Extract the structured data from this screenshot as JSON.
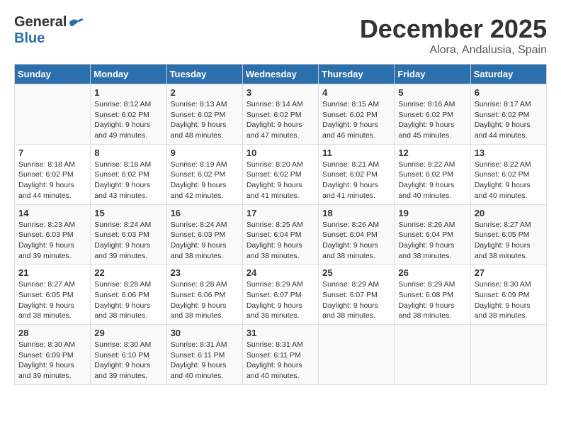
{
  "header": {
    "logo_general": "General",
    "logo_blue": "Blue",
    "month": "December 2025",
    "location": "Alora, Andalusia, Spain"
  },
  "days_of_week": [
    "Sunday",
    "Monday",
    "Tuesday",
    "Wednesday",
    "Thursday",
    "Friday",
    "Saturday"
  ],
  "weeks": [
    [
      {
        "day": "",
        "info": ""
      },
      {
        "day": "1",
        "info": "Sunrise: 8:12 AM\nSunset: 6:02 PM\nDaylight: 9 hours\nand 49 minutes."
      },
      {
        "day": "2",
        "info": "Sunrise: 8:13 AM\nSunset: 6:02 PM\nDaylight: 9 hours\nand 48 minutes."
      },
      {
        "day": "3",
        "info": "Sunrise: 8:14 AM\nSunset: 6:02 PM\nDaylight: 9 hours\nand 47 minutes."
      },
      {
        "day": "4",
        "info": "Sunrise: 8:15 AM\nSunset: 6:02 PM\nDaylight: 9 hours\nand 46 minutes."
      },
      {
        "day": "5",
        "info": "Sunrise: 8:16 AM\nSunset: 6:02 PM\nDaylight: 9 hours\nand 45 minutes."
      },
      {
        "day": "6",
        "info": "Sunrise: 8:17 AM\nSunset: 6:02 PM\nDaylight: 9 hours\nand 44 minutes."
      }
    ],
    [
      {
        "day": "7",
        "info": "Sunrise: 8:18 AM\nSunset: 6:02 PM\nDaylight: 9 hours\nand 44 minutes."
      },
      {
        "day": "8",
        "info": "Sunrise: 8:18 AM\nSunset: 6:02 PM\nDaylight: 9 hours\nand 43 minutes."
      },
      {
        "day": "9",
        "info": "Sunrise: 8:19 AM\nSunset: 6:02 PM\nDaylight: 9 hours\nand 42 minutes."
      },
      {
        "day": "10",
        "info": "Sunrise: 8:20 AM\nSunset: 6:02 PM\nDaylight: 9 hours\nand 41 minutes."
      },
      {
        "day": "11",
        "info": "Sunrise: 8:21 AM\nSunset: 6:02 PM\nDaylight: 9 hours\nand 41 minutes."
      },
      {
        "day": "12",
        "info": "Sunrise: 8:22 AM\nSunset: 6:02 PM\nDaylight: 9 hours\nand 40 minutes."
      },
      {
        "day": "13",
        "info": "Sunrise: 8:22 AM\nSunset: 6:02 PM\nDaylight: 9 hours\nand 40 minutes."
      }
    ],
    [
      {
        "day": "14",
        "info": "Sunrise: 8:23 AM\nSunset: 6:03 PM\nDaylight: 9 hours\nand 39 minutes."
      },
      {
        "day": "15",
        "info": "Sunrise: 8:24 AM\nSunset: 6:03 PM\nDaylight: 9 hours\nand 39 minutes."
      },
      {
        "day": "16",
        "info": "Sunrise: 8:24 AM\nSunset: 6:03 PM\nDaylight: 9 hours\nand 38 minutes."
      },
      {
        "day": "17",
        "info": "Sunrise: 8:25 AM\nSunset: 6:04 PM\nDaylight: 9 hours\nand 38 minutes."
      },
      {
        "day": "18",
        "info": "Sunrise: 8:26 AM\nSunset: 6:04 PM\nDaylight: 9 hours\nand 38 minutes."
      },
      {
        "day": "19",
        "info": "Sunrise: 8:26 AM\nSunset: 6:04 PM\nDaylight: 9 hours\nand 38 minutes."
      },
      {
        "day": "20",
        "info": "Sunrise: 8:27 AM\nSunset: 6:05 PM\nDaylight: 9 hours\nand 38 minutes."
      }
    ],
    [
      {
        "day": "21",
        "info": "Sunrise: 8:27 AM\nSunset: 6:05 PM\nDaylight: 9 hours\nand 38 minutes."
      },
      {
        "day": "22",
        "info": "Sunrise: 8:28 AM\nSunset: 6:06 PM\nDaylight: 9 hours\nand 38 minutes."
      },
      {
        "day": "23",
        "info": "Sunrise: 8:28 AM\nSunset: 6:06 PM\nDaylight: 9 hours\nand 38 minutes."
      },
      {
        "day": "24",
        "info": "Sunrise: 8:29 AM\nSunset: 6:07 PM\nDaylight: 9 hours\nand 38 minutes."
      },
      {
        "day": "25",
        "info": "Sunrise: 8:29 AM\nSunset: 6:07 PM\nDaylight: 9 hours\nand 38 minutes."
      },
      {
        "day": "26",
        "info": "Sunrise: 8:29 AM\nSunset: 6:08 PM\nDaylight: 9 hours\nand 38 minutes."
      },
      {
        "day": "27",
        "info": "Sunrise: 8:30 AM\nSunset: 6:09 PM\nDaylight: 9 hours\nand 38 minutes."
      }
    ],
    [
      {
        "day": "28",
        "info": "Sunrise: 8:30 AM\nSunset: 6:09 PM\nDaylight: 9 hours\nand 39 minutes."
      },
      {
        "day": "29",
        "info": "Sunrise: 8:30 AM\nSunset: 6:10 PM\nDaylight: 9 hours\nand 39 minutes."
      },
      {
        "day": "30",
        "info": "Sunrise: 8:31 AM\nSunset: 6:11 PM\nDaylight: 9 hours\nand 40 minutes."
      },
      {
        "day": "31",
        "info": "Sunrise: 8:31 AM\nSunset: 6:11 PM\nDaylight: 9 hours\nand 40 minutes."
      },
      {
        "day": "",
        "info": ""
      },
      {
        "day": "",
        "info": ""
      },
      {
        "day": "",
        "info": ""
      }
    ]
  ]
}
